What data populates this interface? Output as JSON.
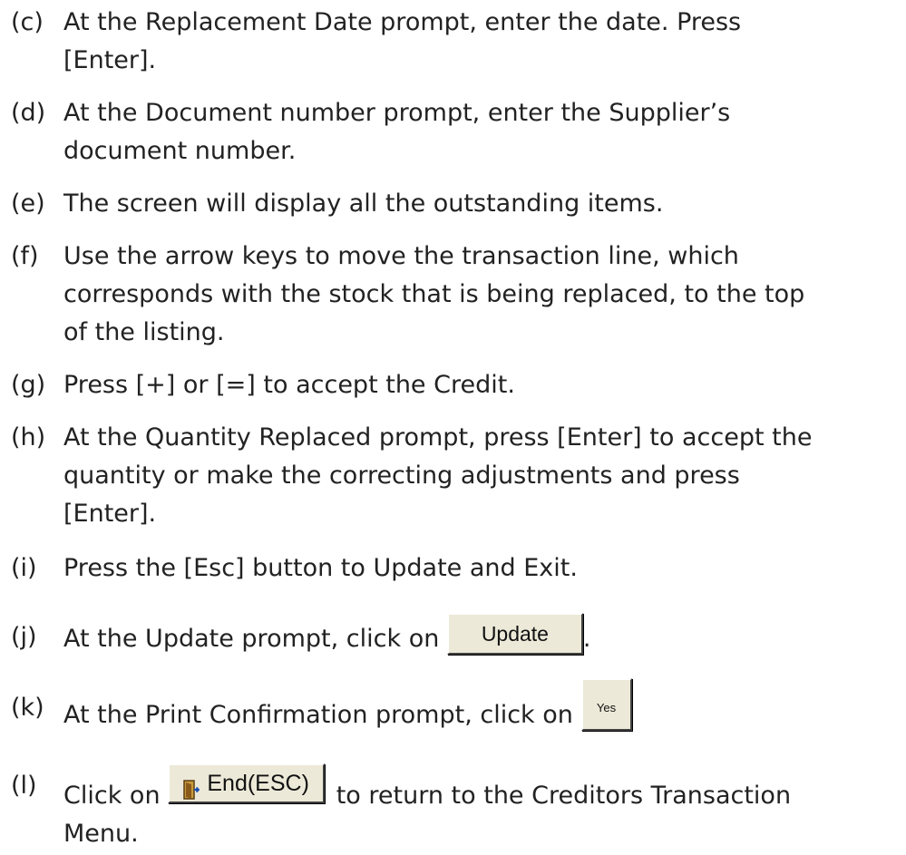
{
  "steps": [
    {
      "marker": "(c)",
      "lines": [
        "At the Replacement Date prompt, enter the date. Press",
        "[Enter]."
      ]
    },
    {
      "marker": "(d)",
      "lines": [
        "At the Document number prompt, enter the Supplier’s",
        "document number."
      ]
    },
    {
      "marker": "(e)",
      "lines": [
        "The screen will display all the outstanding items."
      ]
    },
    {
      "marker": "(f)",
      "lines": [
        "Use the arrow keys to move the transaction line, which",
        "corresponds with the stock that is being replaced, to the top",
        "of the listing."
      ]
    },
    {
      "marker": "(g)",
      "lines": [
        "Press [+] or [=] to accept the Credit."
      ]
    },
    {
      "marker": "(h)",
      "lines": [
        "At the Quantity Replaced prompt, press [Enter] to accept the",
        "quantity or make the correcting adjustments and press",
        "[Enter]."
      ]
    },
    {
      "marker": "(i)",
      "lines": [
        "Press the [Esc] button to Update and Exit."
      ]
    },
    {
      "marker": "(j)",
      "text_before": "At the Update prompt, click on ",
      "button_label": "Update",
      "text_after": "."
    },
    {
      "marker": "(k)",
      "text_before": "At the Print Confirmation prompt, click on ",
      "button_label": "Yes"
    },
    {
      "marker": "(l)",
      "text_before": "Click on ",
      "button_label": "End(ESC)",
      "button_icon": "exit-door-icon",
      "text_after": " to return to the Creditors Transaction",
      "lines_after": [
        "Menu."
      ]
    }
  ]
}
